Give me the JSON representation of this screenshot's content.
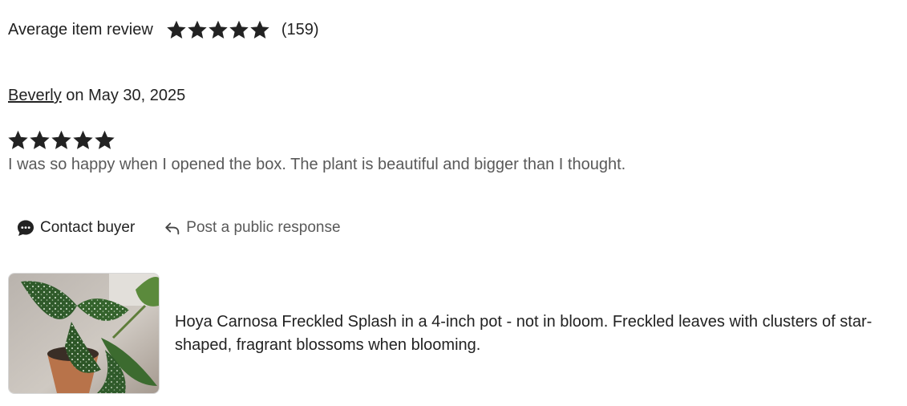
{
  "summary": {
    "label": "Average item review",
    "rating": 5,
    "count_text": "(159)"
  },
  "review": {
    "reviewer": "Beverly",
    "date_text": "on May 30, 2025",
    "rating": 5,
    "text": "I was so happy when I opened the box. The plant is beautiful and bigger than I thought."
  },
  "actions": {
    "contact_label": "Contact buyer",
    "contact_icon": "chat-bubble-icon",
    "respond_label": "Post a public response",
    "respond_icon": "reply-arrow-icon"
  },
  "item": {
    "description": "Hoya Carnosa Freckled Splash in a 4-inch pot - not in bloom. Freckled leaves with clusters of star-shaped, fragrant blossoms when blooming."
  },
  "colors": {
    "text": "#222222",
    "secondary_text": "#595959",
    "star": "#222222"
  }
}
